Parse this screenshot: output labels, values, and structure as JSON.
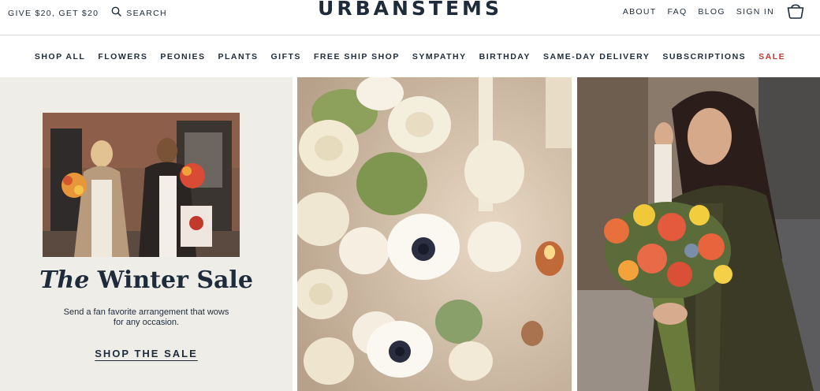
{
  "header": {
    "promo_text": "GIVE $20, GET $20",
    "search_label": "SEARCH",
    "logo_text": "URBANSTEMS",
    "links": [
      "ABOUT",
      "FAQ",
      "BLOG",
      "SIGN IN"
    ],
    "cart_icon": "basket-icon",
    "search_icon": "magnifier-icon"
  },
  "nav": {
    "items": [
      {
        "label": "SHOP ALL"
      },
      {
        "label": "FLOWERS"
      },
      {
        "label": "PEONIES"
      },
      {
        "label": "PLANTS"
      },
      {
        "label": "GIFTS"
      },
      {
        "label": "FREE SHIP SHOP"
      },
      {
        "label": "SYMPATHY"
      },
      {
        "label": "BIRTHDAY"
      },
      {
        "label": "SAME-DAY DELIVERY"
      },
      {
        "label": "SUBSCRIPTIONS"
      },
      {
        "label": "SALE"
      }
    ],
    "sale_color": "#c0392b"
  },
  "hero": {
    "title_italic": "The",
    "title_rest": "Winter Sale",
    "description": "Send a fan favorite arrangement that wows for any occasion.",
    "cta_label": "SHOP THE SALE"
  },
  "colors": {
    "brand_navy": "#1d2b3a",
    "panel_bg": "#efede8"
  }
}
